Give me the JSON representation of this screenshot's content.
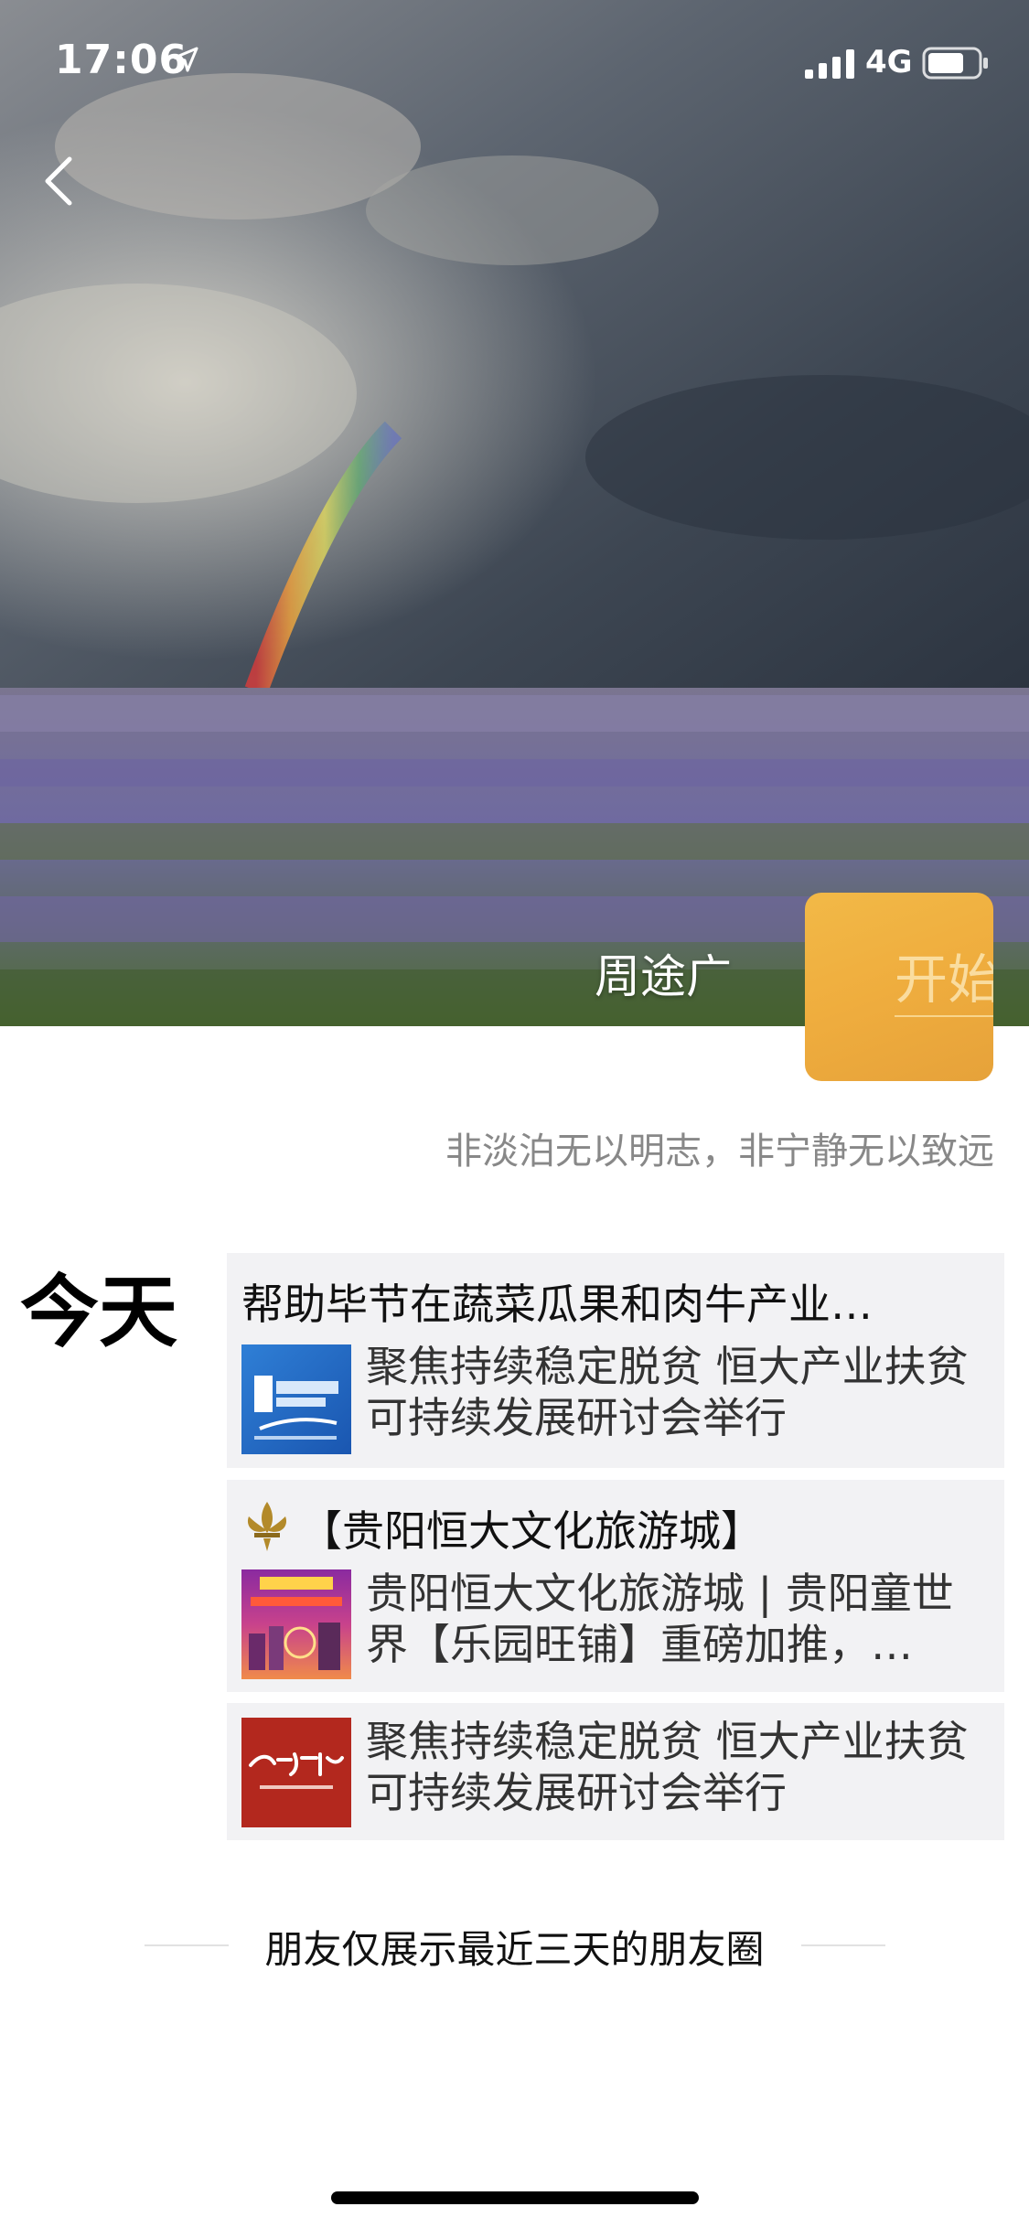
{
  "status_bar": {
    "time": "17:06",
    "network": "4G"
  },
  "profile": {
    "name": "周途广",
    "avatar_text": "开始",
    "signature": "非淡泊无以明志，非宁静无以致远"
  },
  "timeline": {
    "day_label": "今天",
    "posts": [
      {
        "title": "帮助毕节在蔬菜瓜果和肉牛产业…",
        "thumb_icon": "xinhua-news-logo",
        "text": "聚焦持续稳定脱贫 恒大产业扶贫可持续发展研讨会举行"
      },
      {
        "title": "【贵阳恒大文化旅游城】",
        "thumb_icon": "amusement-park-promo",
        "text": "贵阳恒大文化旅游城 | 贵阳童世界【乐园旺铺】重磅加推，…"
      },
      {
        "thumb_icon": "rmzxb-logo",
        "text": "聚焦持续稳定脱贫 恒大产业扶贫可持续发展研讨会举行"
      }
    ]
  },
  "footer": {
    "note": "朋友仅展示最近三天的朋友圈"
  },
  "colors": {
    "avatar": "#efad3e",
    "card_bg": "#f2f2f4",
    "signature": "#888888"
  }
}
